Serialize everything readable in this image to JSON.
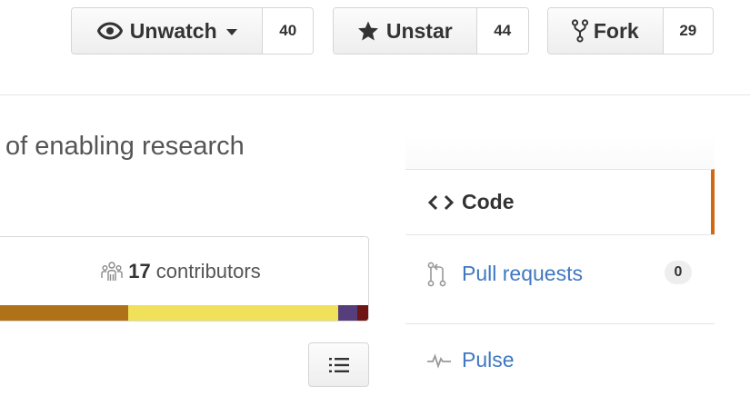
{
  "actions": {
    "watch": {
      "label": "Unwatch",
      "count": "40"
    },
    "star": {
      "label": "Unstar",
      "count": "44"
    },
    "fork": {
      "label": "Fork",
      "count": "29"
    }
  },
  "repo": {
    "description": "of enabling research"
  },
  "summary": {
    "contributors_count": "17",
    "contributors_label": "contributors",
    "language_colors": [
      "#b07219",
      "#f1e05a",
      "#563d7c",
      "#701516"
    ],
    "language_shares": [
      0.36,
      0.56,
      0.05,
      0.03
    ]
  },
  "nav": {
    "code": "Code",
    "pull_requests": "Pull requests",
    "pull_requests_count": "0",
    "pulse": "Pulse"
  },
  "accent": "#d26911",
  "link_color": "#4078c0"
}
